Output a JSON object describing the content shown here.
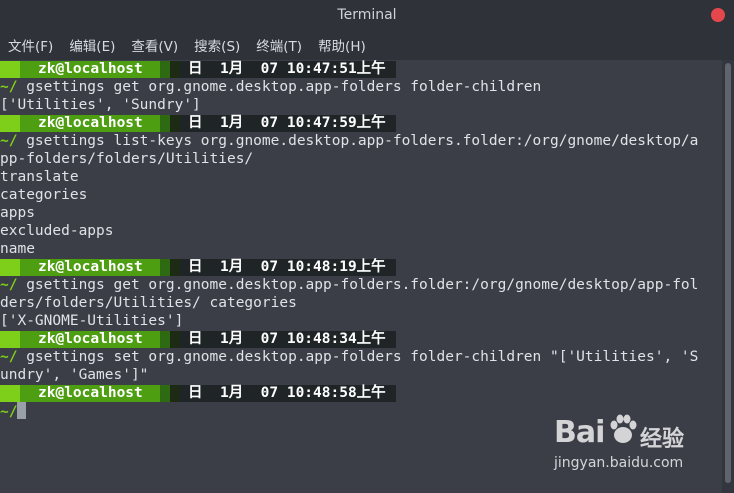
{
  "window": {
    "title": "Terminal"
  },
  "menu": [
    "文件(F)",
    "编辑(E)",
    "查看(V)",
    "搜索(S)",
    "终端(T)",
    "帮助(H)"
  ],
  "prompts": [
    {
      "user": "zk@localhost",
      "datetime": "日  1月  07 10:47:51上午"
    },
    {
      "user": "zk@localhost",
      "datetime": "日  1月  07 10:47:59上午"
    },
    {
      "user": "zk@localhost",
      "datetime": "日  1月  07 10:48:19上午"
    },
    {
      "user": "zk@localhost",
      "datetime": "日  1月  07 10:48:34上午"
    },
    {
      "user": "zk@localhost",
      "datetime": "日  1月  07 10:48:58上午"
    }
  ],
  "prompt_symbol": "~/",
  "commands": [
    " gsettings get org.gnome.desktop.app-folders folder-children",
    " gsettings list-keys org.gnome.desktop.app-folders.folder:/org/gnome/desktop/a",
    " gsettings get org.gnome.desktop.app-folders.folder:/org/gnome/desktop/app-fol",
    " gsettings set org.gnome.desktop.app-folders folder-children \"['Utilities', 'S"
  ],
  "outputs": [
    [
      "['Utilities', 'Sundry']"
    ],
    [
      "pp-folders/folders/Utilities/",
      "translate",
      "categories",
      "apps",
      "excluded-apps",
      "name"
    ],
    [
      "ders/folders/Utilities/ categories",
      "['X-GNOME-Utilities']"
    ],
    [
      "undry', 'Games']\""
    ]
  ],
  "watermark": {
    "logo": "Bai",
    "logo_suffix": "经验",
    "url": "jingyan.baidu.com"
  },
  "colors": {
    "accent_green": "#7ecf19",
    "user_green": "#4e9e12",
    "background": "#3b3e47",
    "close": "#e5474d"
  }
}
